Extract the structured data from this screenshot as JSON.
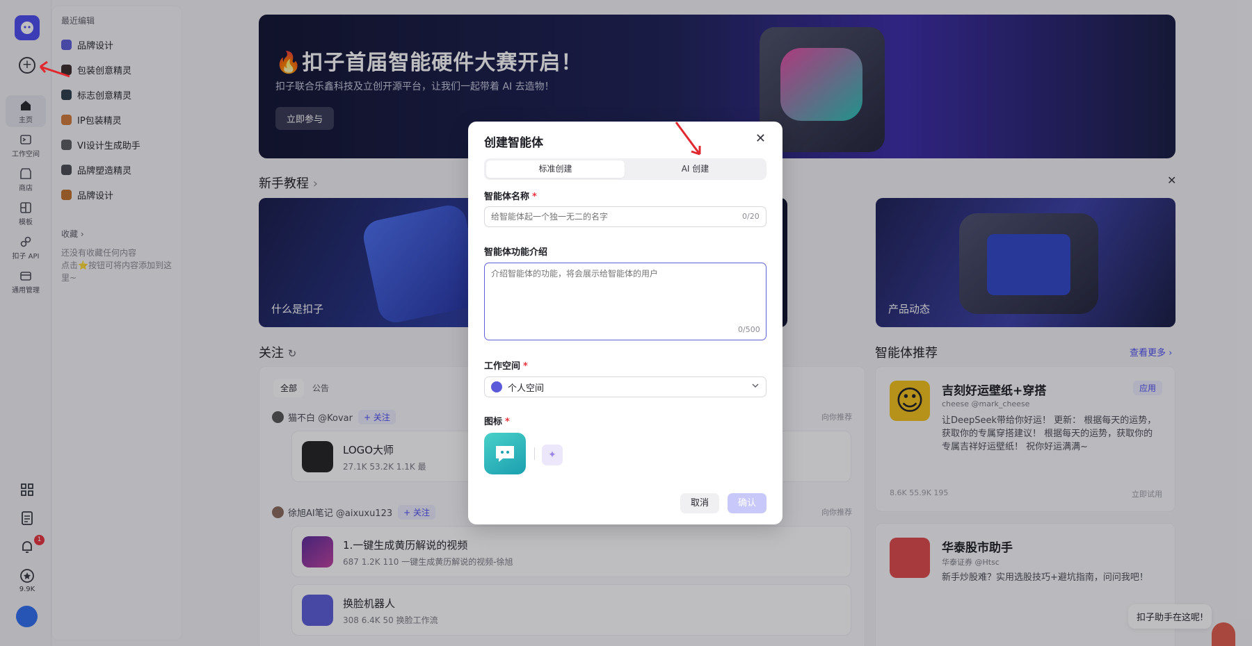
{
  "rail": {
    "items": [
      {
        "label": "主页",
        "icon": "home-icon"
      },
      {
        "label": "工作空间",
        "icon": "workspace-icon"
      },
      {
        "label": "商店",
        "icon": "store-icon"
      },
      {
        "label": "模板",
        "icon": "template-icon"
      },
      {
        "label": "扣子 API",
        "icon": "api-icon"
      },
      {
        "label": "通用管理",
        "icon": "manage-icon"
      }
    ],
    "notification_count": "1",
    "star_count": "9.9K"
  },
  "sidebar": {
    "recent_title": "最近编辑",
    "recent": [
      {
        "label": "品牌设计",
        "color": "#5b5bd9"
      },
      {
        "label": "包装创意精灵",
        "color": "#3a2a2a"
      },
      {
        "label": "标志创意精灵",
        "color": "#2c3c48"
      },
      {
        "label": "IP包装精灵",
        "color": "#d27a3a"
      },
      {
        "label": "VI设计生成助手",
        "color": "#5a5a62"
      },
      {
        "label": "品牌塑造精灵",
        "color": "#4a4a52"
      },
      {
        "label": "品牌设计",
        "color": "#c0722c"
      }
    ],
    "favorites_title": "收藏 ›",
    "favorites_empty": "还没有收藏任何内容",
    "favorites_hint": "点击⭐按钮可将内容添加到这里~"
  },
  "banner": {
    "title": "🔥扣子首届智能硬件大赛开启！",
    "subtitle": "扣子联合乐鑫科技及立创开源平台，让我们一起带着 AI 去造物！",
    "button": "立即参与"
  },
  "tutorial": {
    "heading": "新手教程",
    "cards": [
      "什么是扣子",
      "产品动态"
    ]
  },
  "follow": {
    "heading": "关注",
    "filters": [
      "全部",
      "公告"
    ],
    "posts": [
      {
        "user": "猫不白 @Kovar",
        "follow": "+ 关注",
        "rec": "向你推荐",
        "bot_name": "LOGO大师",
        "stats": "27.1K   53.2K   1.1K   最"
      },
      {
        "user": "徐旭AI笔记 @aixuxu123",
        "follow": "+ 关注",
        "rec": "向你推荐",
        "bot_name": "1.一键生成黄历解说的视频",
        "stats": "687   1.2K   110   一键生成黄历解说的视频-徐旭"
      }
    ],
    "extra_bot": {
      "bot_name": "换脸机器人",
      "stats": "308   6.4K   50   换脸工作流"
    }
  },
  "recommend": {
    "heading": "智能体推荐",
    "more": "查看更多 ›",
    "items": [
      {
        "name": "吉刻好运壁纸+穿搭",
        "author": "cheese @mark_cheese",
        "tag": "应用",
        "desc": "让DeepSeek带给你好运！ 更新： 根据每天的运势，获取你的专属穿搭建议！ 根据每天的运势，获取你的专属吉祥好运壁纸！ 祝你好运满满~",
        "stats": "8.6K   55.9K   195",
        "try": "立即试用"
      },
      {
        "name": "华泰股市助手",
        "author": "华泰证券 @Htsc",
        "desc": "新手炒股难？实用选股技巧+避坑指南，问问我吧！"
      }
    ]
  },
  "assistant": "扣子助手在这呢!",
  "modal": {
    "title": "创建智能体",
    "tabs": [
      "标准创建",
      "AI 创建"
    ],
    "name_label": "智能体名称",
    "name_placeholder": "给智能体起一个独一无二的名字",
    "name_counter": "0/20",
    "desc_label": "智能体功能介绍",
    "desc_placeholder": "介绍智能体的功能，将会展示给智能体的用户",
    "desc_counter": "0/500",
    "workspace_label": "工作空间",
    "workspace_value": "个人空间",
    "icon_label": "图标",
    "required_mark": "*",
    "cancel": "取消",
    "confirm": "确认"
  },
  "colors": {
    "accent": "#4c4cf0",
    "danger": "#e8333d",
    "arrow": "#e0282e"
  }
}
